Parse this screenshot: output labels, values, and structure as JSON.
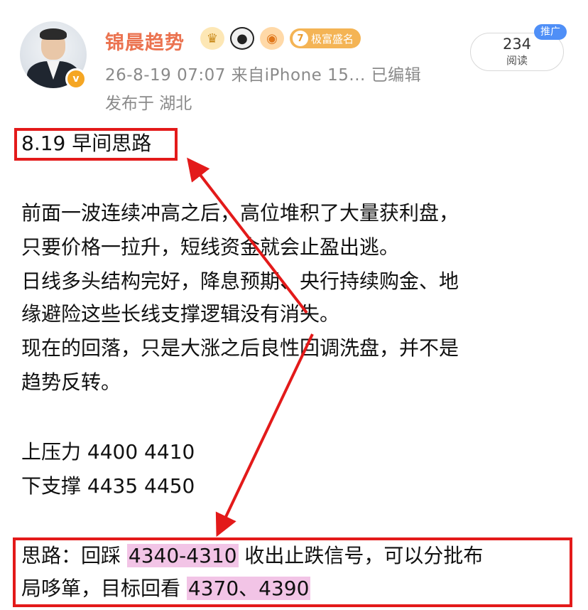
{
  "post": {
    "username": "锦晨趋势",
    "verified_badge": "v",
    "rank_badge_number": "7",
    "rank_badge_label": "极富盛名",
    "timestamp_source": "26-8-19 07:07  来自iPhone 15...  已编辑",
    "location": "发布于 湖北",
    "read_count": "234",
    "read_label": "阅读",
    "promo_label": "推广"
  },
  "content": {
    "title": "8.19 早间思路",
    "lines": [
      "前面一波连续冲高之后，高位堆积了大量获利盘，",
      "只要价格一拉升，短线资金就会止盈出逃。",
      "日线多头结构完好，降息预期、央行持续购金、地",
      "缘避险这些长线支撑逻辑没有消失。",
      "现在的回落，只是大涨之后良性回调洗盘，并不是",
      "趋势反转。"
    ],
    "pressure": "上压力 4400 4410",
    "support": "下支撑 4435 4450",
    "strategy": {
      "part1": "思路：回踩 ",
      "range": "4340-4310",
      "part2": " 收出止跌信号，可以分批布",
      "line2_prefix": "局哆箪，目标回看 ",
      "targets": "4370、4390"
    }
  },
  "colors": {
    "username": "#eb7350",
    "annotation_red": "#e31a1a",
    "highlight": "#f2c4e6",
    "meta_gray": "#8a8a8a",
    "promo_blue": "#4f8ff7"
  }
}
